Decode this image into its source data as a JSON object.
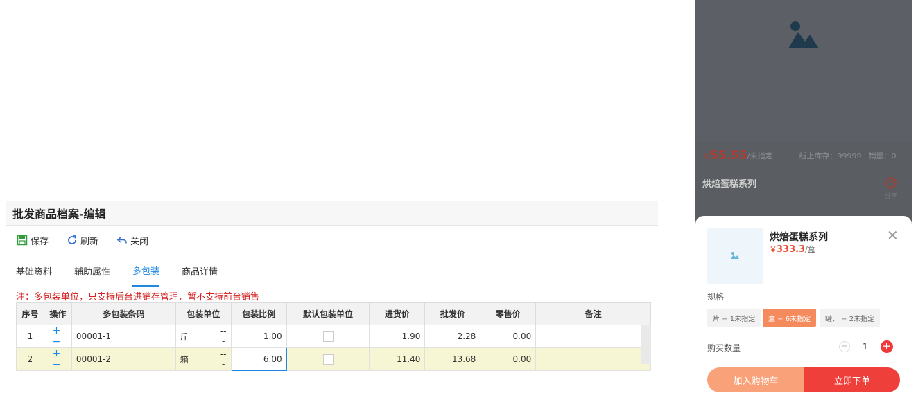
{
  "window": {
    "title": "批发商品档案-编辑",
    "toolbar": {
      "save": "保存",
      "refresh": "刷新",
      "close": "关闭"
    },
    "tabs": [
      "基础资料",
      "辅助属性",
      "多包装",
      "商品详情"
    ],
    "active_tab": "多包装",
    "notice": "注：多包装单位，只支持后台进销存管理，暂不支持前台销售",
    "table": {
      "headers": [
        "序号",
        "操作",
        "多包装条码",
        "包装单位",
        "包装比例",
        "默认包装单位",
        "进货价",
        "批发价",
        "零售价",
        "备注"
      ],
      "rows": [
        {
          "no": "1",
          "barcode": "00001-1",
          "unit": "斤",
          "dash": "---",
          "ratio": "1.00",
          "buy": "1.90",
          "wholesale": "2.28",
          "retail": "0.00",
          "note": ""
        },
        {
          "no": "2",
          "barcode": "00001-2",
          "unit": "箱",
          "dash": "---",
          "ratio": "6.00",
          "buy": "11.40",
          "wholesale": "13.68",
          "retail": "0.00",
          "note": ""
        }
      ]
    }
  },
  "mobile": {
    "price_bar": {
      "currency": "￥",
      "price": "55.55",
      "unit": "/未指定",
      "stock": "线上库存：99999",
      "sales": "销量：0"
    },
    "product_name": "烘焙蛋糕系列",
    "share": "分享",
    "sheet": {
      "name": "烘焙蛋糕系列",
      "currency": "￥",
      "price": "333.3",
      "unit": "/盒",
      "spec_label": "规格",
      "specs": [
        "片 = 1未指定",
        "盒 = 6未指定",
        "罐、 = 2未指定"
      ],
      "selected_spec": "盒 = 6未指定",
      "qty_label": "购买数量",
      "qty": "1",
      "add_cart": "加入购物车",
      "buy_now": "立即下单"
    }
  },
  "colors": {
    "accent": "#1e88e5",
    "notice": "#d42020",
    "selected_row": "#f6f5d4",
    "buy": "#ee3f3b",
    "cart": "#f9a27a"
  }
}
